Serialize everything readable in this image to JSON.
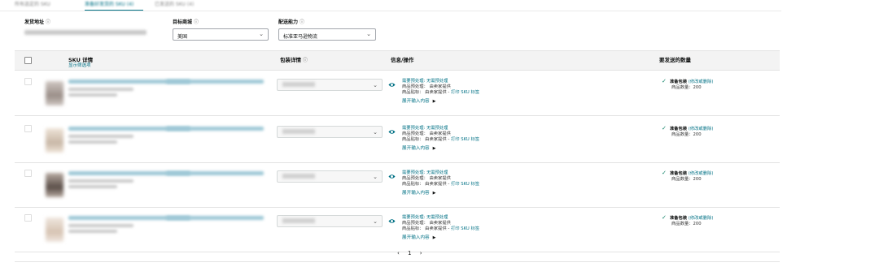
{
  "tabs": [
    {
      "label": "所有选定的 SKU",
      "active": false
    },
    {
      "label": "准备好发货的 SKU (4)",
      "active": true
    },
    {
      "label": "已发送的 SKU (4)",
      "active": false
    }
  ],
  "filters": {
    "ship_from": {
      "label": "发货地址",
      "info_icon": "info-icon"
    },
    "marketplace": {
      "label": "目标商城",
      "info_icon": "info-icon",
      "value": "美国"
    },
    "fulfillment": {
      "label": "配送能力",
      "info_icon": "info-icon",
      "value": "标准亚马逊物流"
    }
  },
  "table": {
    "headers": {
      "sku": "SKU 详情",
      "sku_sub": "显示筛选项",
      "pack": "包装详情",
      "info": "信息/操作",
      "qty": "要发送的数量"
    },
    "rows": [
      {
        "pack_placeholder": "单件商品",
        "prep_line": "需要预处理: 无需预处理",
        "prep_by": "商品预处理： 由卖家提供",
        "label_prefix": "商品贴标： 由卖家提供 - ",
        "label_link": "打印 SKU 标签",
        "expand": "展开输入内容",
        "ready": "准备包装",
        "edit": "(修改或删除)",
        "qty": "商品数量：200"
      },
      {
        "pack_placeholder": "",
        "prep_line": "需要预处理: 无需预处理",
        "prep_by": "商品预处理： 由卖家提供",
        "label_prefix": "商品贴标： 由卖家提供 - ",
        "label_link": "打印 SKU 标签",
        "expand": "展开输入内容",
        "ready": "准备包装",
        "edit": "(修改或删除)",
        "qty": "商品数量：200"
      },
      {
        "pack_placeholder": "",
        "prep_line": "需要预处理: 无需预处理",
        "prep_by": "商品预处理： 由卖家提供",
        "label_prefix": "商品贴标： 由卖家提供 - ",
        "label_link": "打印 SKU 标签",
        "expand": "展开输入内容",
        "ready": "准备包装",
        "edit": "(修改或删除)",
        "qty": "商品数量：200"
      },
      {
        "pack_placeholder": "",
        "prep_line": "需要预处理: 无需预处理",
        "prep_by": "商品预处理： 由卖家提供",
        "label_prefix": "商品贴标： 由卖家提供 - ",
        "label_link": "打印 SKU 标签",
        "expand": "展开输入内容",
        "ready": "准备包装",
        "edit": "(修改或删除)",
        "qty": "商品数量：200"
      }
    ]
  },
  "pagination": {
    "prev": "‹",
    "page": "1",
    "next": "›"
  },
  "colors": {
    "link": "#007185",
    "success": "#067d62",
    "header_bg": "#f3f3f3"
  }
}
